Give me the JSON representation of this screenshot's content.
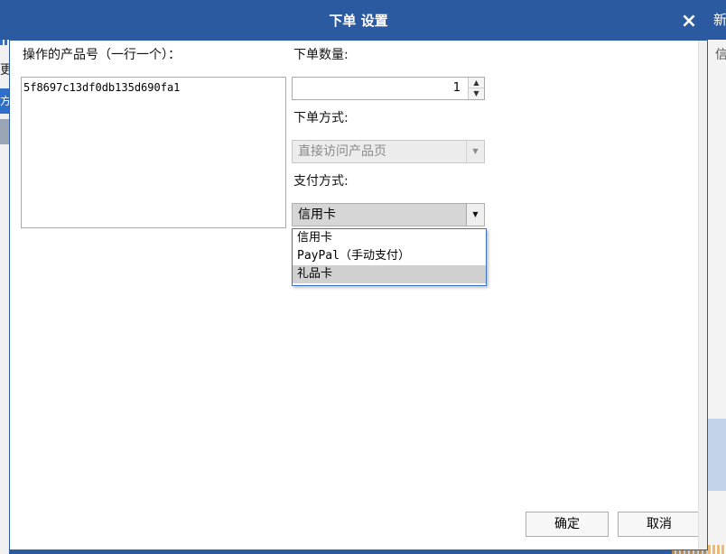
{
  "dialog": {
    "title": "下单 设置",
    "close_glyph": "×"
  },
  "product_ids": {
    "label": "操作的产品号（一行一个）：",
    "value": "5f8697c13df0db135d690fa1"
  },
  "quantity": {
    "label": "下单数量:",
    "value": "1",
    "up_glyph": "▲",
    "down_glyph": "▼"
  },
  "order_method": {
    "label": "下单方式:",
    "selected": "直接访问产品页",
    "disabled": true
  },
  "payment_method": {
    "label": "支付方式:",
    "selected": "信用卡",
    "options": [
      {
        "label": "信用卡"
      },
      {
        "label": "PayPal（手动支付）"
      },
      {
        "label": "礼品卡"
      }
    ],
    "highlighted_index": 2
  },
  "buttons": {
    "ok": "确定",
    "cancel": "取消"
  },
  "background": {
    "left_text": "更",
    "left_tab": "方",
    "right_top": "新",
    "right_text": "信"
  },
  "icons": {
    "dropdown_arrow": "▼"
  },
  "colors": {
    "titlebar": "#2c5aa0",
    "list_border": "#3d74c0"
  }
}
